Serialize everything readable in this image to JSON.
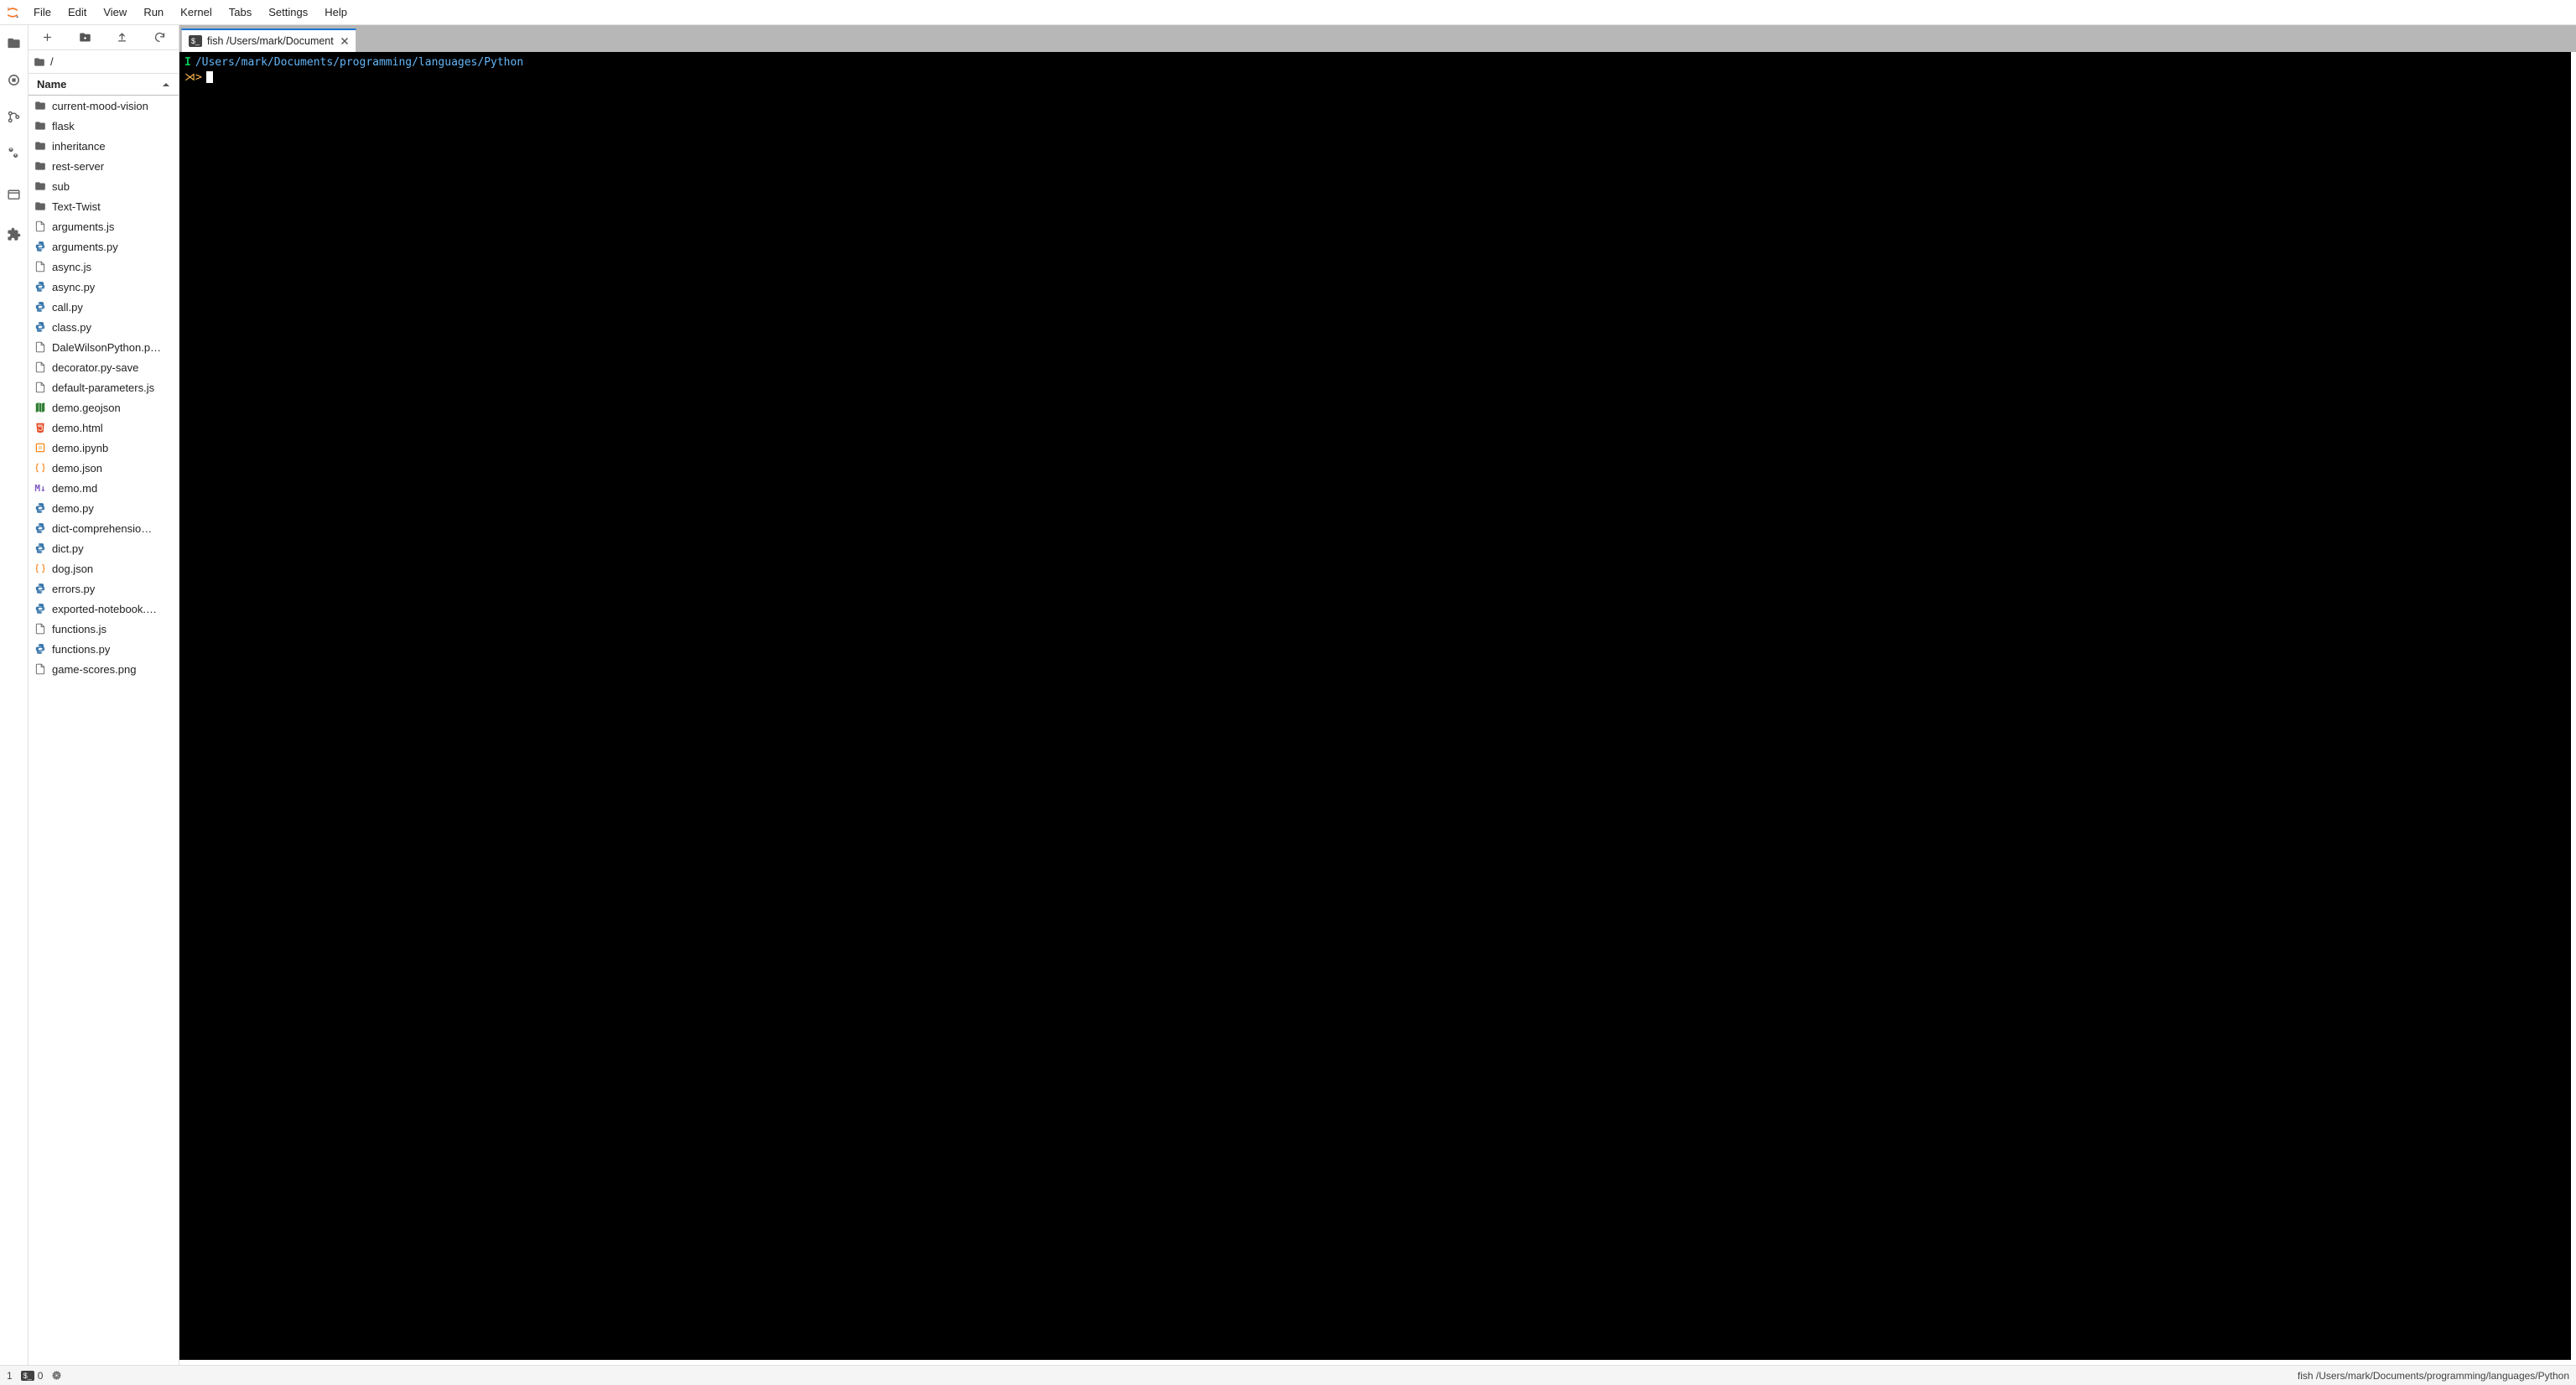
{
  "menubar": {
    "items": [
      "File",
      "Edit",
      "View",
      "Run",
      "Kernel",
      "Tabs",
      "Settings",
      "Help"
    ]
  },
  "activity": {
    "items": [
      {
        "name": "folder-icon"
      },
      {
        "name": "running-icon"
      },
      {
        "name": "git-icon"
      },
      {
        "name": "settings-icon"
      },
      {
        "name": "tabs-icon"
      },
      {
        "name": "extension-icon"
      }
    ]
  },
  "filebrowser": {
    "breadcrumb_label": "/",
    "name_header": "Name",
    "items": [
      {
        "label": "current-mood-vision",
        "kind": "folder"
      },
      {
        "label": "flask",
        "kind": "folder"
      },
      {
        "label": "inheritance",
        "kind": "folder"
      },
      {
        "label": "rest-server",
        "kind": "folder"
      },
      {
        "label": "sub",
        "kind": "folder"
      },
      {
        "label": "Text-Twist",
        "kind": "folder"
      },
      {
        "label": "arguments.js",
        "kind": "file"
      },
      {
        "label": "arguments.py",
        "kind": "py"
      },
      {
        "label": "async.js",
        "kind": "file"
      },
      {
        "label": "async.py",
        "kind": "py"
      },
      {
        "label": "call.py",
        "kind": "py"
      },
      {
        "label": "class.py",
        "kind": "py"
      },
      {
        "label": "DaleWilsonPython.p…",
        "kind": "file"
      },
      {
        "label": "decorator.py-save",
        "kind": "file"
      },
      {
        "label": "default-parameters.js",
        "kind": "file"
      },
      {
        "label": "demo.geojson",
        "kind": "geo"
      },
      {
        "label": "demo.html",
        "kind": "html"
      },
      {
        "label": "demo.ipynb",
        "kind": "nb"
      },
      {
        "label": "demo.json",
        "kind": "json"
      },
      {
        "label": "demo.md",
        "kind": "md"
      },
      {
        "label": "demo.py",
        "kind": "py"
      },
      {
        "label": "dict-comprehensio…",
        "kind": "py"
      },
      {
        "label": "dict.py",
        "kind": "py"
      },
      {
        "label": "dog.json",
        "kind": "json"
      },
      {
        "label": "errors.py",
        "kind": "py"
      },
      {
        "label": "exported-notebook.…",
        "kind": "py"
      },
      {
        "label": "functions.js",
        "kind": "file"
      },
      {
        "label": "functions.py",
        "kind": "py"
      },
      {
        "label": "game-scores.png",
        "kind": "file"
      }
    ]
  },
  "tab": {
    "label": "fish /Users/mark/Document"
  },
  "terminal": {
    "indicator": "I",
    "cwd": "/Users/mark/Documents/programming/languages/Python",
    "prompt": "⋊>"
  },
  "statusbar": {
    "left_count": "1",
    "term_count": "0",
    "right_text": "fish /Users/mark/Documents/programming/languages/Python"
  }
}
